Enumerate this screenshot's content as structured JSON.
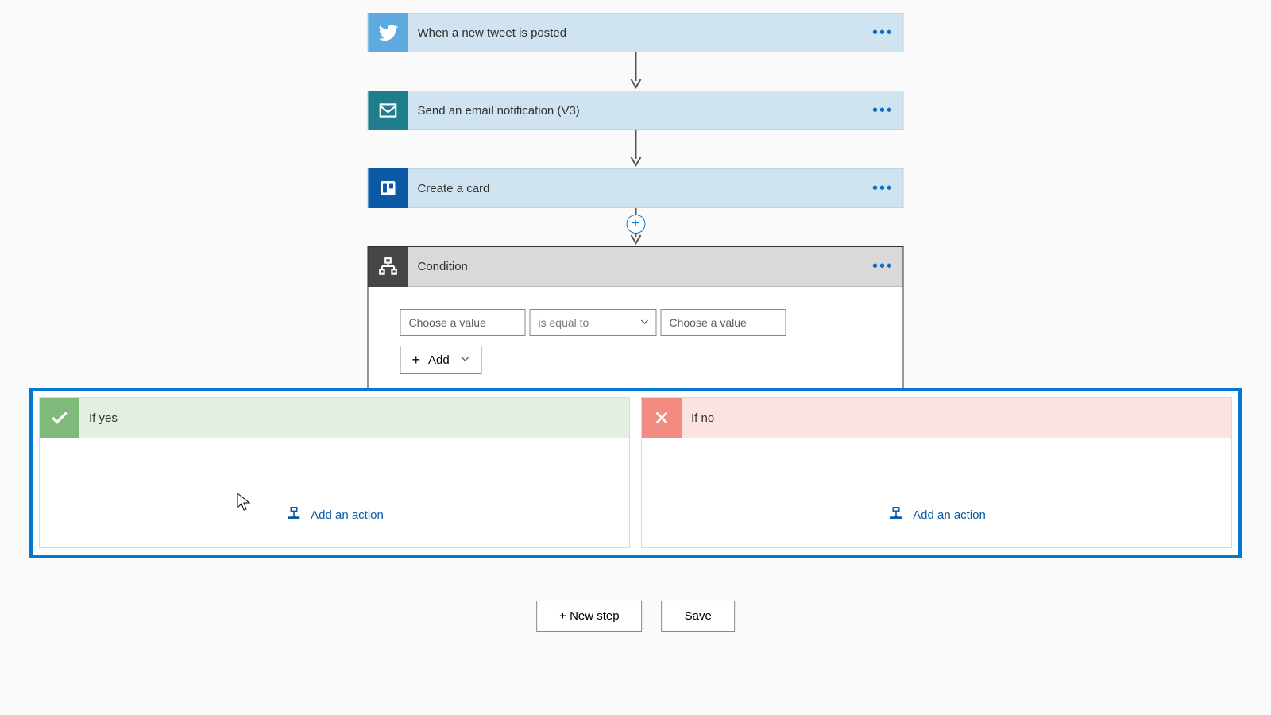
{
  "steps": {
    "twitter": {
      "title": "When a new tweet is posted",
      "icon_color": "#5ea9dd"
    },
    "email": {
      "title": "Send an email notification (V3)",
      "icon_color": "#1f7e8c"
    },
    "trello": {
      "title": "Create a card",
      "icon_color": "#0b5aa6"
    }
  },
  "condition": {
    "title": "Condition",
    "left_placeholder": "Choose a value",
    "operator_label": "is equal to",
    "right_placeholder": "Choose a value",
    "add_label": "Add"
  },
  "branches": {
    "yes": {
      "title": "If yes",
      "add_action_label": "Add an action"
    },
    "no": {
      "title": "If no",
      "add_action_label": "Add an action"
    }
  },
  "footer": {
    "new_step": "+ New step",
    "save": "Save"
  },
  "ellipsis": "•••"
}
